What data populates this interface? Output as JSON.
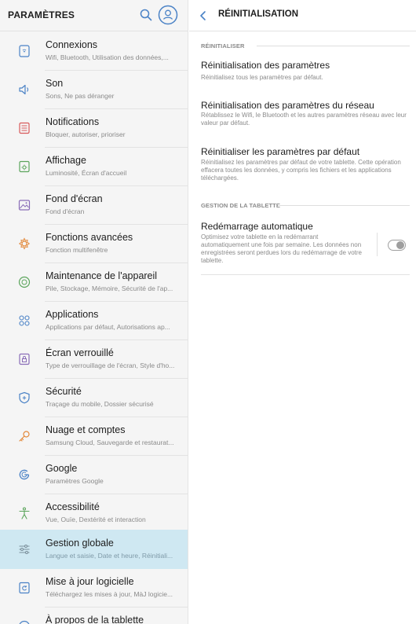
{
  "left_panel": {
    "title": "PARAMÈTRES",
    "items": [
      {
        "title": "Connexions",
        "subtitle": "Wifi, Bluetooth, Utilisation des données,...",
        "icon": "connections-icon"
      },
      {
        "title": "Son",
        "subtitle": "Sons, Ne pas déranger",
        "icon": "sound-icon"
      },
      {
        "title": "Notifications",
        "subtitle": "Bloquer, autoriser, prioriser",
        "icon": "notifications-icon"
      },
      {
        "title": "Affichage",
        "subtitle": "Luminosité, Écran d'accueil",
        "icon": "display-icon"
      },
      {
        "title": "Fond d'écran",
        "subtitle": "Fond d'écran",
        "icon": "wallpaper-icon"
      },
      {
        "title": "Fonctions avancées",
        "subtitle": "Fonction multifenêtre",
        "icon": "advanced-features-icon"
      },
      {
        "title": "Maintenance de l'appareil",
        "subtitle": "Pile, Stockage, Mémoire, Sécurité de l'ap...",
        "icon": "device-maintenance-icon"
      },
      {
        "title": "Applications",
        "subtitle": "Applications par défaut, Autorisations ap...",
        "icon": "applications-icon"
      },
      {
        "title": "Écran verrouillé",
        "subtitle": "Type de verrouillage de l'écran, Style d'ho...",
        "icon": "lock-screen-icon"
      },
      {
        "title": "Sécurité",
        "subtitle": "Traçage du mobile, Dossier sécurisé",
        "icon": "security-icon"
      },
      {
        "title": "Nuage et comptes",
        "subtitle": "Samsung Cloud, Sauvegarde et restaurat...",
        "icon": "cloud-accounts-icon"
      },
      {
        "title": "Google",
        "subtitle": "Paramètres Google",
        "icon": "google-icon"
      },
      {
        "title": "Accessibilité",
        "subtitle": "Vue, Ouïe, Dextérité et interaction",
        "icon": "accessibility-icon"
      },
      {
        "title": "Gestion globale",
        "subtitle": "Langue et saisie, Date et heure, Réinitiali...",
        "icon": "general-management-icon"
      },
      {
        "title": "Mise à jour logicielle",
        "subtitle": "Téléchargez les mises à jour, MàJ logicie...",
        "icon": "software-update-icon"
      },
      {
        "title": "À propos de la tablette",
        "subtitle": "",
        "icon": "about-tablet-icon"
      }
    ],
    "active_index": 13
  },
  "right_panel": {
    "title": "RÉINITIALISATION",
    "section_reset": "RÉINITIALISER",
    "section_tablet": "GESTION DE LA TABLETTE",
    "options": [
      {
        "title": "Réinitialisation des paramètres",
        "description": "Réinitialisez tous les paramètres par défaut."
      },
      {
        "title": "Réinitialisation des paramètres du réseau",
        "description": "Rétablissez le Wifi, le Bluetooth et les autres paramètres réseau avec leur valeur par défaut."
      },
      {
        "title": "Réinitialiser les paramètres par défaut",
        "description": "Réinitialisez les paramètres par défaut de votre tablette. Cette opération effacera toutes les données, y compris les fichiers et les applications téléchargées."
      }
    ],
    "auto_restart": {
      "title": "Redémarrage automatique",
      "description": "Optimisez votre tablette en la redémarrant automatiquement une fois par semaine. Les données non enregistrées seront perdues lors du redémarrage de votre tablette.",
      "enabled": false
    }
  },
  "colors": {
    "accent": "#3d8fc8",
    "active_row": "#cfe8f2",
    "icon_blue": "#4a82c6",
    "icon_orange": "#e38a3c",
    "icon_green": "#5ba55c",
    "icon_red": "#d8595a",
    "icon_purple": "#8a6db8"
  }
}
